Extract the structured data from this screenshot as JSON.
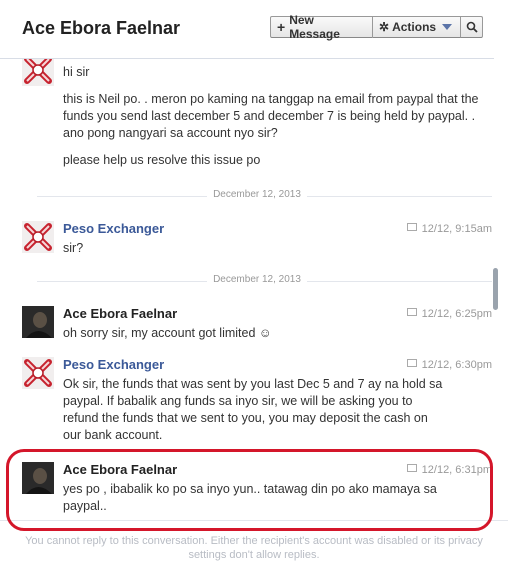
{
  "header": {
    "title": "Ace Ebora Faelnar",
    "new_message_label": "New Message",
    "actions_label": "Actions",
    "search_icon": "search-icon"
  },
  "messages": [
    {
      "sender": "",
      "time": "",
      "paragraphs": [
        "hi sir",
        "this is Neil po. . meron po kaming na tanggap na email from paypal that the funds you send last december 5 and december 7 is being held by paypal. . ano pong nangyari sa account nyo sir?",
        "please help us resolve this issue po"
      ]
    },
    {
      "sender": "Peso Exchanger",
      "time": "12/12, 9:15am",
      "paragraphs": [
        "sir?"
      ]
    },
    {
      "sender": "Ace Ebora Faelnar",
      "time": "12/12, 6:25pm",
      "paragraphs": [
        "oh sorry sir, my account got limited ☺"
      ]
    },
    {
      "sender": "Peso Exchanger",
      "time": "12/12, 6:30pm",
      "paragraphs": [
        "Ok sir, the funds that was sent by you last Dec 5 and 7 ay na hold sa paypal. If babalik ang funds sa inyo sir, we will be asking you to refund the funds that we sent to you, you may deposit the cash on our bank account."
      ]
    },
    {
      "sender": "Ace Ebora Faelnar",
      "time": "12/12, 6:31pm",
      "paragraphs": [
        "yes po , ibabalik ko po sa inyo yun.. tatawag din po ako mamaya sa paypal.."
      ]
    }
  ],
  "separators": [
    "December 12, 2013",
    "December 12, 2013"
  ],
  "footer": {
    "notice": "You cannot reply to this conversation. Either the recipient's account was disabled or its privacy settings don't allow replies."
  },
  "colors": {
    "link": "#3b5998",
    "highlight": "#d4162a"
  }
}
